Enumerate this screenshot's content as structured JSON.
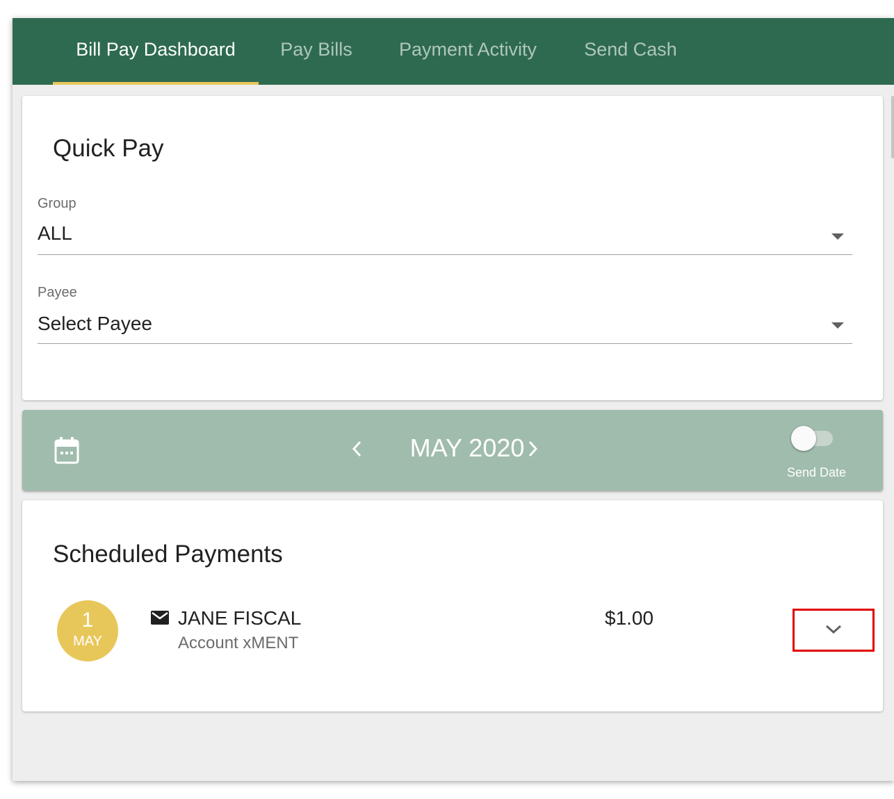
{
  "nav": {
    "tabs": [
      {
        "label": "Bill Pay Dashboard",
        "active": true
      },
      {
        "label": "Pay Bills",
        "active": false
      },
      {
        "label": "Payment Activity",
        "active": false
      },
      {
        "label": "Send Cash",
        "active": false
      }
    ]
  },
  "quick_pay": {
    "title": "Quick Pay",
    "group": {
      "label": "Group",
      "value": "ALL"
    },
    "payee": {
      "label": "Payee",
      "value": "Select Payee"
    }
  },
  "calendar": {
    "month": "MAY 2020",
    "toggle_label": "Send Date",
    "toggle_on": false,
    "icons": [
      "calendar-icon",
      "chevron-left-icon",
      "chevron-right-icon"
    ]
  },
  "scheduled": {
    "title": "Scheduled Payments",
    "payments": [
      {
        "day": "1",
        "month": "MAY",
        "name": "JANE FISCAL",
        "account": "Account xMENT",
        "amount": "$1.00",
        "delivery_icon": "mail-icon"
      }
    ]
  },
  "colors": {
    "nav_bg": "#2e6a4f",
    "accent": "#e8c75a",
    "calendar_bar": "#a0bcac",
    "highlight_box": "#e00000"
  }
}
